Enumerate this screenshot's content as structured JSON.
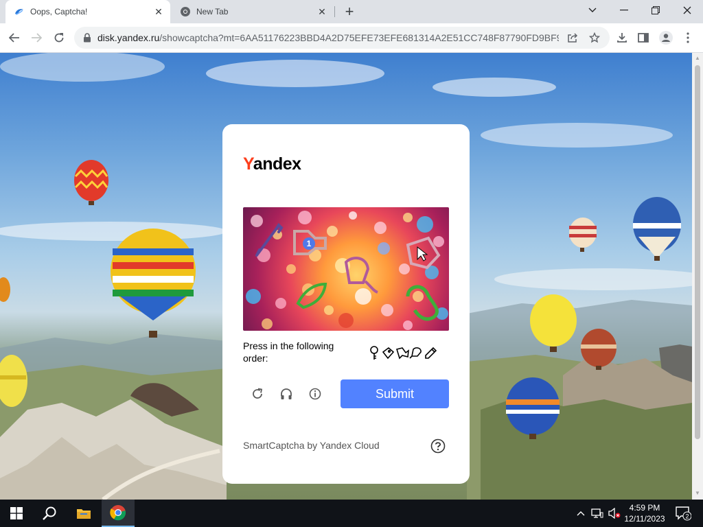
{
  "browser": {
    "tabs": [
      {
        "title": "Oops, Captcha!",
        "active": true,
        "favicon": "yandex-disk-icon"
      },
      {
        "title": "New Tab",
        "active": false,
        "favicon": "chrome-icon"
      }
    ],
    "url": {
      "host": "disk.yandex.ru",
      "path": "/showcaptcha?mt=6AA51176223BBD4A2D75EFE73EFE681314A2E51CC748F87790FD9BF9873..."
    }
  },
  "captcha": {
    "logo_first": "Y",
    "logo_rest": "andex",
    "instruction": "Press in the following order:",
    "image_marker": "1",
    "submit_label": "Submit",
    "footer": "SmartCaptcha by Yandex Cloud",
    "order_icons": [
      "key-icon",
      "tag-icon",
      "horn-icon",
      "bell-icon",
      "pencil-icon"
    ],
    "controls": [
      "refresh-icon",
      "audio-icon",
      "info-icon"
    ],
    "accent_color": "#5282ff",
    "brand_red": "#fc3f1d"
  },
  "taskbar": {
    "time": "4:59 PM",
    "date": "12/11/2023",
    "notification_count": "2"
  }
}
